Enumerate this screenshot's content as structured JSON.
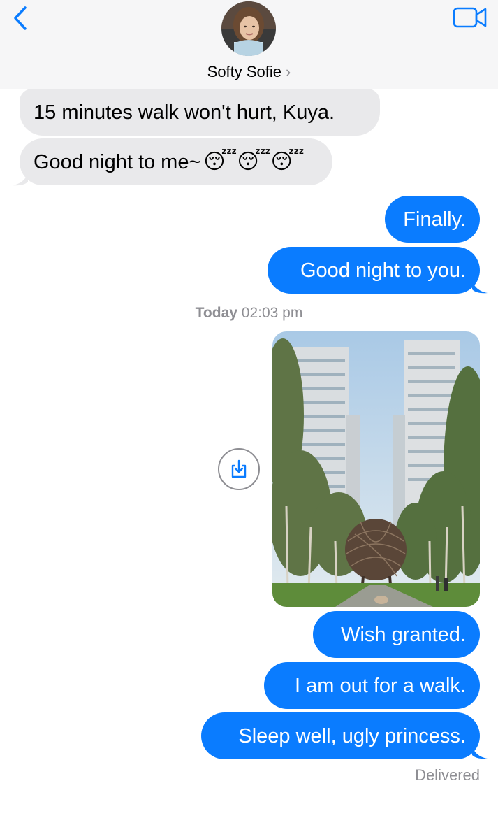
{
  "header": {
    "back_icon": "chevron-left-icon",
    "contact_name": "Softy Sofie",
    "contact_chevron": "›",
    "video_icon": "video-camera-icon",
    "accent_color": "#0a7cff"
  },
  "messages": {
    "in_1": "15 minutes walk won't hurt, Kuya.",
    "in_2": "Good night to me~",
    "in_2_emoji": "😴😴😴",
    "out_1": "Finally.",
    "out_2": "Good night to you.",
    "out_3": "Wish granted.",
    "out_4": "I am out for a walk.",
    "out_5": "Sleep well, ugly princess."
  },
  "timestamp": {
    "day": "Today",
    "time": "02:03 pm"
  },
  "attachment": {
    "download_icon": "download-icon"
  },
  "status": {
    "delivered": "Delivered"
  },
  "colors": {
    "incoming_bubble": "#e9e9eb",
    "outgoing_bubble": "#0a7cff",
    "secondary_text": "#8e8e93"
  }
}
